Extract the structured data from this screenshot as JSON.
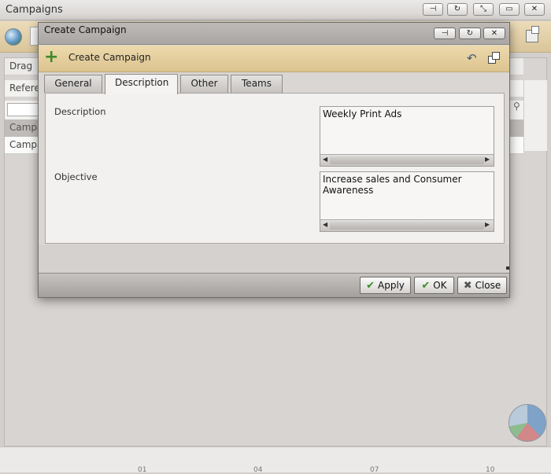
{
  "outer_window": {
    "title": "Campaigns",
    "rows": {
      "drag": "Drag",
      "reference": "Refere",
      "campaign_1": "Campai",
      "campaign_2": "Campa"
    },
    "bottom_ticks": [
      "01",
      "04",
      "07",
      "10"
    ]
  },
  "dialog": {
    "title": "Create Campaign",
    "header_title": "Create Campaign",
    "tabs": [
      {
        "label": "General",
        "active": false
      },
      {
        "label": "Description",
        "active": true
      },
      {
        "label": "Other",
        "active": false
      },
      {
        "label": "Teams",
        "active": false
      }
    ],
    "fields": {
      "description": {
        "label": "Description",
        "value": "Weekly Print Ads"
      },
      "objective": {
        "label": "Objective",
        "value": "Increase sales and Consumer Awareness"
      }
    },
    "footer": {
      "apply_label": "Apply",
      "ok_label": "OK",
      "close_label": "Close"
    }
  },
  "colors": {
    "header_tan": "#dcc48f",
    "accent_green": "#3c8a24"
  },
  "icons": [
    "pin-icon",
    "refresh-icon",
    "restore-icon",
    "maximize-icon",
    "close-icon",
    "plus-icon",
    "undo-icon",
    "popout-icon",
    "check-icon",
    "globe-icon",
    "pie-chart-icon",
    "key-icon"
  ]
}
